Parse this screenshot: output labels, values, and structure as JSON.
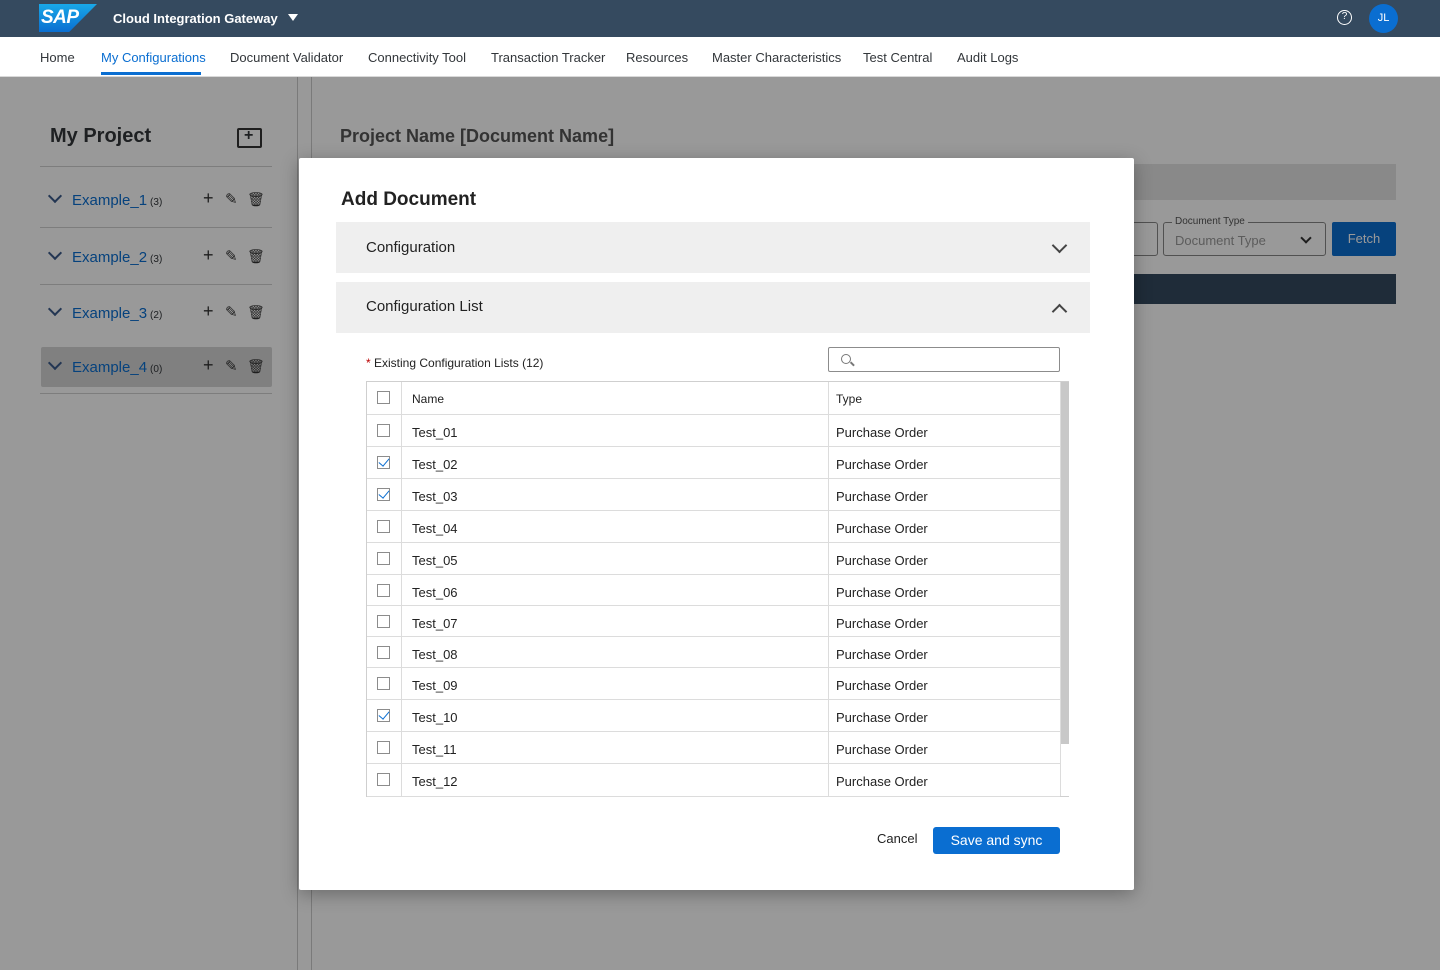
{
  "shell": {
    "logo_text": "SAP",
    "app_title": "Cloud Integration Gateway",
    "help_icon": "help-icon",
    "user_initials": "JL"
  },
  "nav": {
    "tabs": [
      {
        "label": "Home",
        "active": false
      },
      {
        "label": "My Configurations",
        "active": true
      },
      {
        "label": "Document Validator",
        "active": false
      },
      {
        "label": "Connectivity Tool",
        "active": false
      },
      {
        "label": "Transaction Tracker",
        "active": false
      },
      {
        "label": "Resources",
        "active": false
      },
      {
        "label": "Master Characteristics",
        "active": false
      },
      {
        "label": "Test Central",
        "active": false
      },
      {
        "label": "Audit Logs",
        "active": false
      }
    ]
  },
  "sidebar": {
    "title": "My Project",
    "items": [
      {
        "label": "Example_1",
        "count": "(3)"
      },
      {
        "label": "Example_2",
        "count": "(3)"
      },
      {
        "label": "Example_3",
        "count": "(2)"
      },
      {
        "label": "Example_4",
        "count": "(0)",
        "selected": true
      }
    ]
  },
  "background": {
    "project_name": "Project Name [Document Name]",
    "doc_type_legend": "Document Type",
    "doc_type_placeholder": "Document Type",
    "fetch_label": "Fetch"
  },
  "dialog": {
    "title": "Add Document",
    "panels": [
      {
        "title": "Configuration",
        "expanded": false
      },
      {
        "title": "Configuration List",
        "expanded": true
      }
    ],
    "list_label": "Existing Configuration Lists (12)",
    "required_marker": "*",
    "search_placeholder": "",
    "columns": [
      "Name",
      "Type"
    ],
    "rows": [
      {
        "name": "Test_01",
        "type": "Purchase Order",
        "checked": false
      },
      {
        "name": "Test_02",
        "type": "Purchase Order",
        "checked": true
      },
      {
        "name": "Test_03",
        "type": "Purchase Order",
        "checked": true
      },
      {
        "name": "Test_04",
        "type": "Purchase Order",
        "checked": false
      },
      {
        "name": "Test_05",
        "type": "Purchase Order",
        "checked": false
      },
      {
        "name": "Test_06",
        "type": "Purchase Order",
        "checked": false
      },
      {
        "name": "Test_07",
        "type": "Purchase Order",
        "checked": false
      },
      {
        "name": "Test_08",
        "type": "Purchase Order",
        "checked": false
      },
      {
        "name": "Test_09",
        "type": "Purchase Order",
        "checked": false
      },
      {
        "name": "Test_10",
        "type": "Purchase Order",
        "checked": true
      },
      {
        "name": "Test_11",
        "type": "Purchase Order",
        "checked": false
      },
      {
        "name": "Test_12",
        "type": "Purchase Order",
        "checked": false
      }
    ],
    "cancel_label": "Cancel",
    "save_label": "Save and sync"
  },
  "colors": {
    "shell_bg": "#354a5f",
    "accent": "#0a6ed1",
    "required": "#bb0000"
  }
}
